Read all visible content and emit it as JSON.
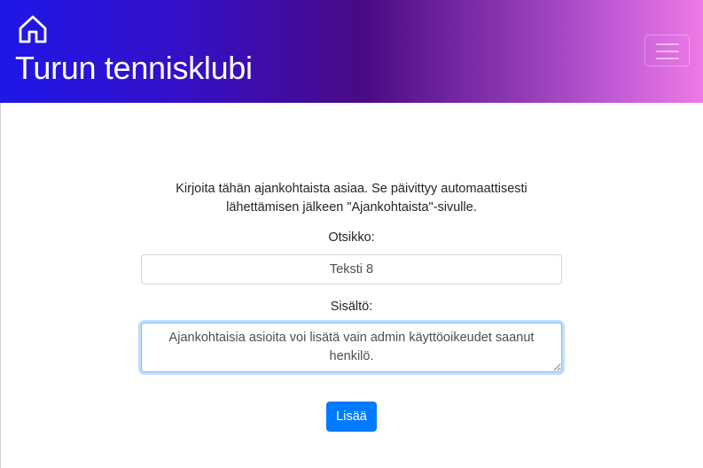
{
  "header": {
    "brand_title": "Turun tennisklubi",
    "home_icon": "home-icon",
    "menu_icon": "hamburger-menu-icon",
    "gradient_colors": [
      "#1e17e8",
      "#4a0a84",
      "#ef79e6"
    ]
  },
  "form": {
    "intro_line1": "Kirjoita tähän ajankohtaista asiaa. Se päivittyy automaattisesti",
    "intro_line2": "lähettämisen jälkeen \"Ajankohtaista\"-sivulle.",
    "title_label": "Otsikko:",
    "title_value": "Teksti 8",
    "content_label": "Sisältö:",
    "content_value": "Ajankohtaisia asioita voi lisätä vain admin käyttöoikeudet saanut henkilö.",
    "submit_label": "Lisää",
    "accent_color": "#007bff"
  }
}
